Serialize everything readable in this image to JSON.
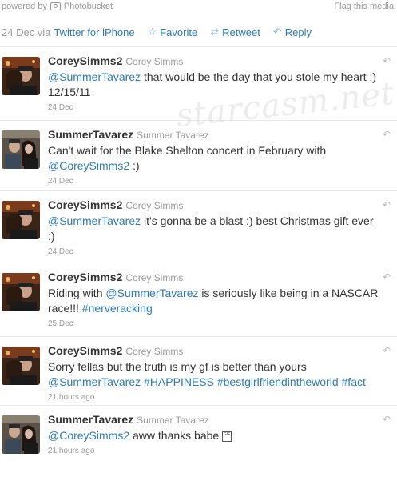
{
  "topbar": {
    "powered_by": "powered by",
    "photobucket": "Photobucket",
    "flag": "Flag this media"
  },
  "meta": {
    "date": "24 Dec via",
    "via_link": "Twitter for iPhone",
    "favorite": "Favorite",
    "retweet": "Retweet",
    "reply": "Reply"
  },
  "watermark": "starcasm.net",
  "tweets": [
    {
      "screen_name": "CoreySimms2",
      "real_name": "Corey Simms",
      "segments": [
        {
          "t": "m",
          "v": "@SummerTavarez"
        },
        {
          "t": "p",
          "v": " that would be the day that you stole my heart :) 12/15/11"
        }
      ],
      "time": "24 Dec"
    },
    {
      "screen_name": "SummerTavarez",
      "real_name": "Summer Tavarez",
      "segments": [
        {
          "t": "p",
          "v": "Can't wait for the Blake Shelton concert in February with "
        },
        {
          "t": "m",
          "v": "@CoreySimms2"
        },
        {
          "t": "p",
          "v": " :)"
        }
      ],
      "time": "24 Dec"
    },
    {
      "screen_name": "CoreySimms2",
      "real_name": "Corey Simms",
      "segments": [
        {
          "t": "m",
          "v": "@SummerTavarez"
        },
        {
          "t": "p",
          "v": " it's gonna be a blast :) best Christmas gift ever :)"
        }
      ],
      "time": "24 Dec"
    },
    {
      "screen_name": "CoreySimms2",
      "real_name": "Corey Simms",
      "segments": [
        {
          "t": "p",
          "v": "Riding with "
        },
        {
          "t": "m",
          "v": "@SummerTavarez"
        },
        {
          "t": "p",
          "v": " is seriously like being in a NASCAR race!!! "
        },
        {
          "t": "h",
          "v": "#nerveracking"
        }
      ],
      "time": "25 Dec"
    },
    {
      "screen_name": "CoreySimms2",
      "real_name": "Corey Simms",
      "segments": [
        {
          "t": "p",
          "v": "Sorry fellas but the truth is my gf is better than yours "
        },
        {
          "t": "m",
          "v": "@SummerTavarez"
        },
        {
          "t": "p",
          "v": " "
        },
        {
          "t": "h",
          "v": "#HAPPINESS"
        },
        {
          "t": "p",
          "v": " "
        },
        {
          "t": "h",
          "v": "#bestgirlfriendintheworld"
        },
        {
          "t": "p",
          "v": " "
        },
        {
          "t": "h",
          "v": "#fact"
        }
      ],
      "time": "21 hours ago"
    },
    {
      "screen_name": "SummerTavarez",
      "real_name": "Summer Tavarez",
      "segments": [
        {
          "t": "m",
          "v": "@CoreySimms2"
        },
        {
          "t": "p",
          "v": " aww thanks babe "
        }
      ],
      "gift_glyph": "GIF",
      "time": "21 hours ago"
    }
  ]
}
